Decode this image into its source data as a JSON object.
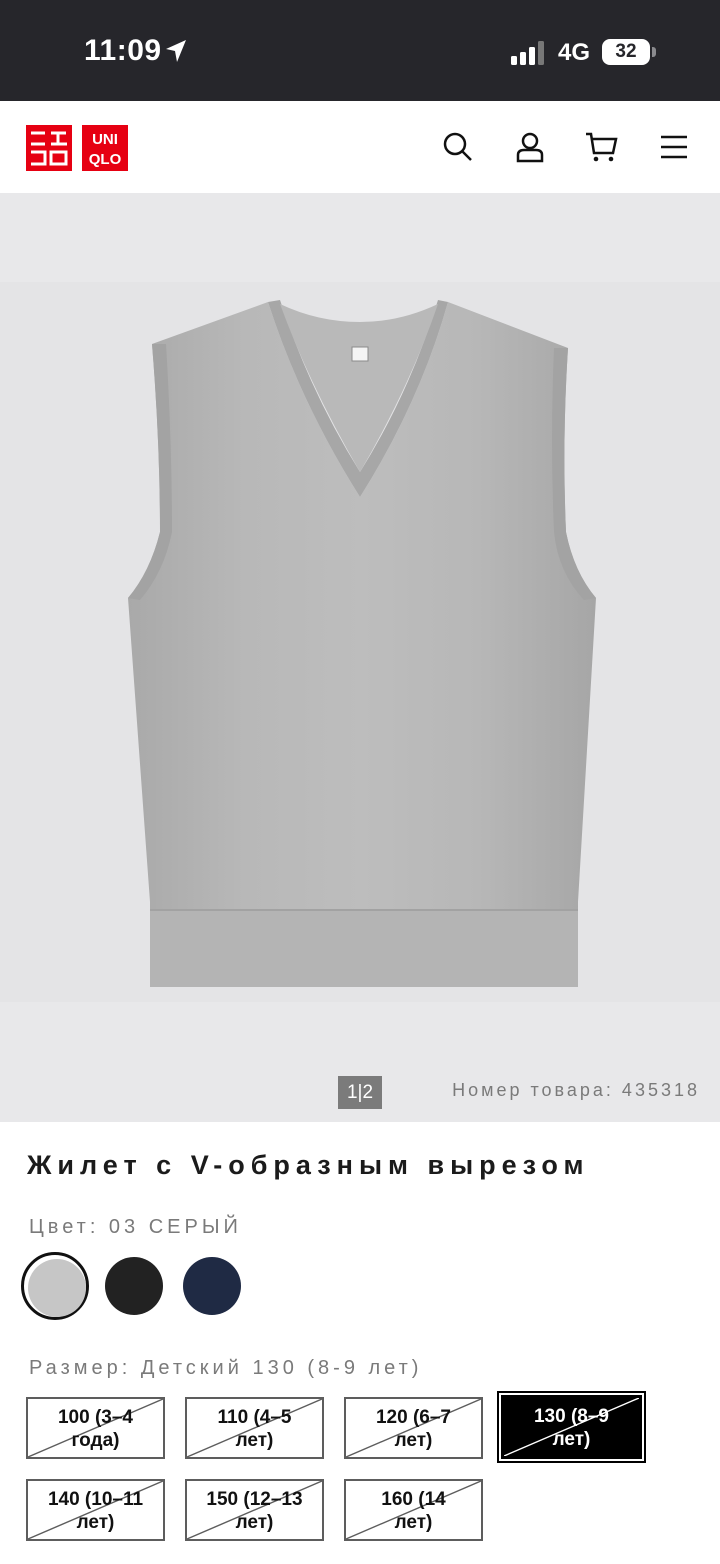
{
  "status_bar": {
    "time": "11:09",
    "network": "4G",
    "battery": "32"
  },
  "header": {
    "logo_text_1": "ユニ",
    "logo_text_2": "クロ",
    "logo_text_3": "UNI",
    "logo_text_4": "QLO"
  },
  "gallery": {
    "pager": "1|2",
    "article_number": "Номер товара: 435318"
  },
  "product": {
    "title": "Жилет с V-образным вырезом",
    "color_label": "Цвет: 03 СЕРЫЙ",
    "size_label": "Размер: Детский 130 (8-9 лет)"
  },
  "swatches": [
    {
      "name": "gray",
      "color": "#c8c8c8"
    },
    {
      "name": "black",
      "color": "#222222"
    },
    {
      "name": "navy",
      "color": "#1f2a44"
    }
  ],
  "sizes": [
    {
      "line1": "100 (3–4",
      "line2": "года)"
    },
    {
      "line1": "110 (4–5",
      "line2": "лет)"
    },
    {
      "line1": "120 (6–7",
      "line2": "лет)"
    },
    {
      "line1": "130 (8–9",
      "line2": "лет)"
    },
    {
      "line1": "140 (10–11",
      "line2": "лет)"
    },
    {
      "line1": "150 (12–13",
      "line2": "лет)"
    },
    {
      "line1": "160 (14",
      "line2": "лет)"
    }
  ],
  "colors": {
    "brand_red": "#e60012",
    "status_bar": "#26262b"
  }
}
